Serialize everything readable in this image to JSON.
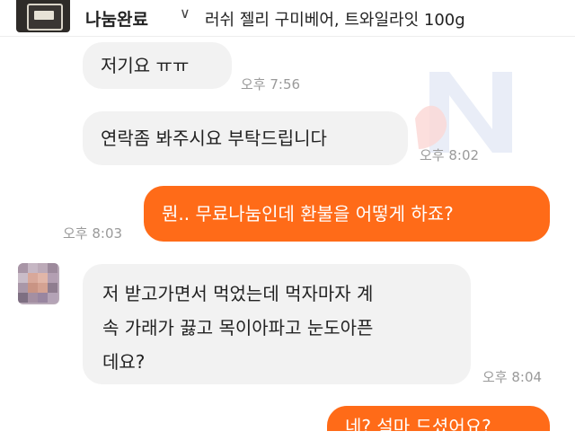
{
  "header": {
    "status": "나눔완료",
    "caret": "∨",
    "product_title": "러쉬 젤리 구미베어, 트와일라잇 100g"
  },
  "messages": [
    {
      "text": "저기요 ㅠㅠ",
      "time": "오후 7:56"
    },
    {
      "text": "연락좀 봐주시요 부탁드립니다",
      "time": "오후 8:02"
    },
    {
      "text": "뭔.. 무료나눔인데 환불을 어떻게 하죠?",
      "time": "오후 8:03"
    },
    {
      "lines": [
        "저 받고가면서 먹었는데 먹자마자 계",
        "속 가래가 끓고 목이아파고 눈도아픈",
        "데요?"
      ],
      "time": "오후 8:04"
    },
    {
      "text": "네? 설마 드셨어요?"
    }
  ],
  "colors": {
    "outgoing_bubble": "#ff6b18",
    "incoming_bubble": "#f2f2f2",
    "timestamp": "#9a9a9a"
  }
}
